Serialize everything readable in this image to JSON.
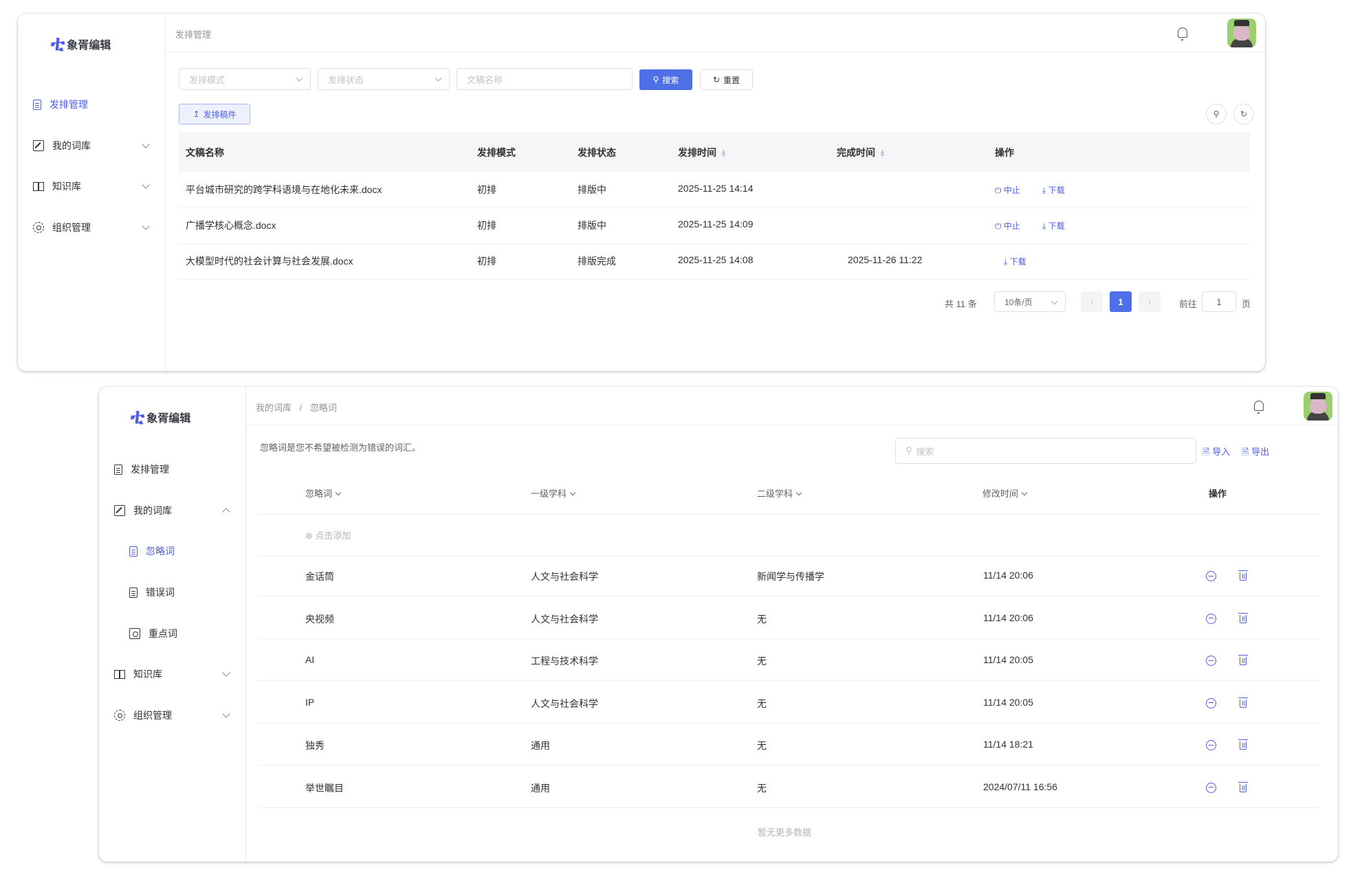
{
  "app": {
    "logo_mark": "ቲ",
    "logo_text": "象胥编辑"
  },
  "window1": {
    "sidebar": [
      {
        "label": "发排管理",
        "active": true
      },
      {
        "label": "我的词库"
      },
      {
        "label": "知识库"
      },
      {
        "label": "组织管理"
      }
    ],
    "breadcrumb": "发排管理",
    "filters": {
      "mode_placeholder": "发排模式",
      "status_placeholder": "发排状态",
      "name_placeholder": "文稿名称",
      "search_label": "搜索",
      "reset_label": "重置"
    },
    "upload_label": "发排稿件",
    "table": {
      "headers": [
        "文稿名称",
        "发排模式",
        "发排状态",
        "发排时间",
        "完成时间",
        "操作"
      ],
      "rows": [
        {
          "name": "平台城市研究的跨学科语境与在地化未来.docx",
          "mode": "初排",
          "status": "排版中",
          "start": "2025-11-25 14:14",
          "end": "",
          "actions": [
            "中止",
            "下载"
          ]
        },
        {
          "name": "广播学核心概念.docx",
          "mode": "初排",
          "status": "排版中",
          "start": "2025-11-25 14:09",
          "end": "",
          "actions": [
            "中止",
            "下载"
          ]
        },
        {
          "name": "大模型时代的社会计算与社会发展.docx",
          "mode": "初排",
          "status": "排版完成",
          "start": "2025-11-25 14:08",
          "end": "2025-11-26 11:22",
          "actions": [
            "下载"
          ]
        }
      ]
    },
    "pagination": {
      "total": "共 11 条",
      "page_size": "10条/页",
      "current": "1",
      "goto_label": "前往",
      "goto_value": "1",
      "page_unit": "页"
    }
  },
  "window2": {
    "sidebar": [
      {
        "label": "发排管理"
      },
      {
        "label": "我的词库",
        "expanded": true
      },
      {
        "label": "忽略词",
        "active": true,
        "sub": true
      },
      {
        "label": "错误词",
        "sub": true
      },
      {
        "label": "重点词",
        "sub": true
      },
      {
        "label": "知识库"
      },
      {
        "label": "组织管理"
      }
    ],
    "breadcrumb": {
      "parent": "我的词库",
      "separator": "/",
      "current": "忽略词"
    },
    "description": "忽略词是您不希望被检测为错误的词汇。",
    "search_placeholder": "搜索",
    "import_label": "导入",
    "export_label": "导出",
    "table": {
      "headers": [
        "忽略词",
        "一级学科",
        "二级学科",
        "修改时间",
        "操作"
      ],
      "add_label": "点击添加",
      "rows": [
        {
          "word": "金话筒",
          "level1": "人文与社会科学",
          "level2": "新闻学与传播学",
          "time": "11/14 20:06"
        },
        {
          "word": "央视频",
          "level1": "人文与社会科学",
          "level2": "无",
          "time": "11/14 20:06"
        },
        {
          "word": "AI",
          "level1": "工程与技术科学",
          "level2": "无",
          "time": "11/14 20:05"
        },
        {
          "word": "IP",
          "level1": "人文与社会科学",
          "level2": "无",
          "time": "11/14 20:05"
        },
        {
          "word": "独秀",
          "level1": "通用",
          "level2": "无",
          "time": "11/14 18:21"
        },
        {
          "word": "举世瞩目",
          "level1": "通用",
          "level2": "无",
          "time": "2024/07/11 16:56"
        }
      ],
      "empty_text": "暂无更多数据"
    }
  },
  "colors": {
    "accent": "#4f5ce6",
    "primary_button": "#4f6fe6"
  }
}
